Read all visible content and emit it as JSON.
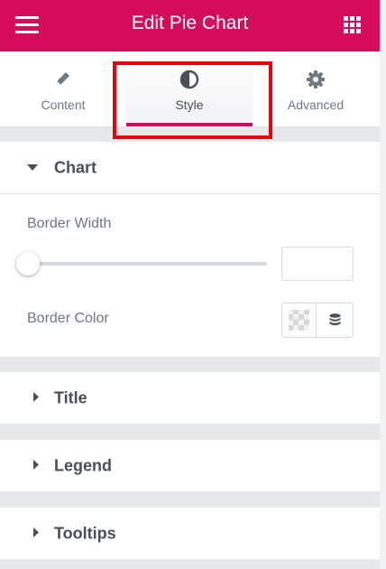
{
  "header": {
    "title": "Edit Pie Chart",
    "menu_icon": "hamburger-menu-icon",
    "grid_icon": "apps-grid-icon",
    "color": "#d30c5c"
  },
  "tabs": [
    {
      "label": "Content",
      "icon": "pencil-icon"
    },
    {
      "label": "Style",
      "icon": "contrast-half-circle-icon",
      "active": true
    },
    {
      "label": "Advanced",
      "icon": "gear-icon"
    }
  ],
  "sections": {
    "chart": {
      "label": "Chart",
      "expanded": true,
      "border_width": {
        "label": "Border Width",
        "value": ""
      },
      "border_color": {
        "label": "Border Color",
        "swatch_icon": "checkerboard-swatch",
        "globals_icon": "database-globals-icon"
      }
    },
    "title": {
      "label": "Title",
      "expanded": false
    },
    "legend": {
      "label": "Legend",
      "expanded": false
    },
    "tooltips": {
      "label": "Tooltips",
      "expanded": false
    }
  },
  "colors": {
    "accent": "#d30c5c",
    "highlight": "#e8020c",
    "text": "#495157",
    "muted": "#6d7882"
  }
}
